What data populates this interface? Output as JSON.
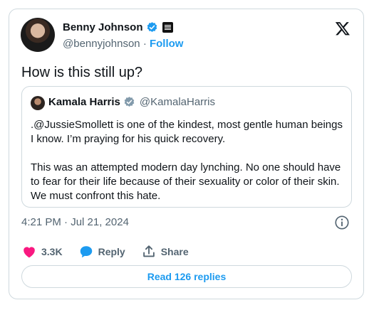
{
  "author": {
    "name": "Benny Johnson",
    "handle": "@bennyjohnson",
    "separator": "·",
    "follow_label": "Follow"
  },
  "tweet_text": "How is this still up?",
  "quoted": {
    "name": "Kamala Harris",
    "handle": "@KamalaHarris",
    "paragraph1": ".@JussieSmollett is one of the kindest, most gentle human beings I know. I’m praying for his quick recovery.",
    "paragraph2": "This was an attempted modern day lynching. No one should have to fear for their life because of their sexuality or color of their skin. We must confront this hate."
  },
  "timestamp": "4:21 PM · Jul 21, 2024",
  "actions": {
    "likes": "3.3K",
    "reply_label": "Reply",
    "share_label": "Share"
  },
  "read_replies_label": "Read 126 replies",
  "colors": {
    "accent": "#1d9bf0",
    "like": "#f91880",
    "muted": "#536471",
    "border": "#cfd9de"
  },
  "icons": [
    "verified-badge-icon",
    "affiliate-badge-icon",
    "x-logo-icon",
    "info-icon",
    "heart-icon",
    "reply-bubble-icon",
    "share-icon"
  ]
}
